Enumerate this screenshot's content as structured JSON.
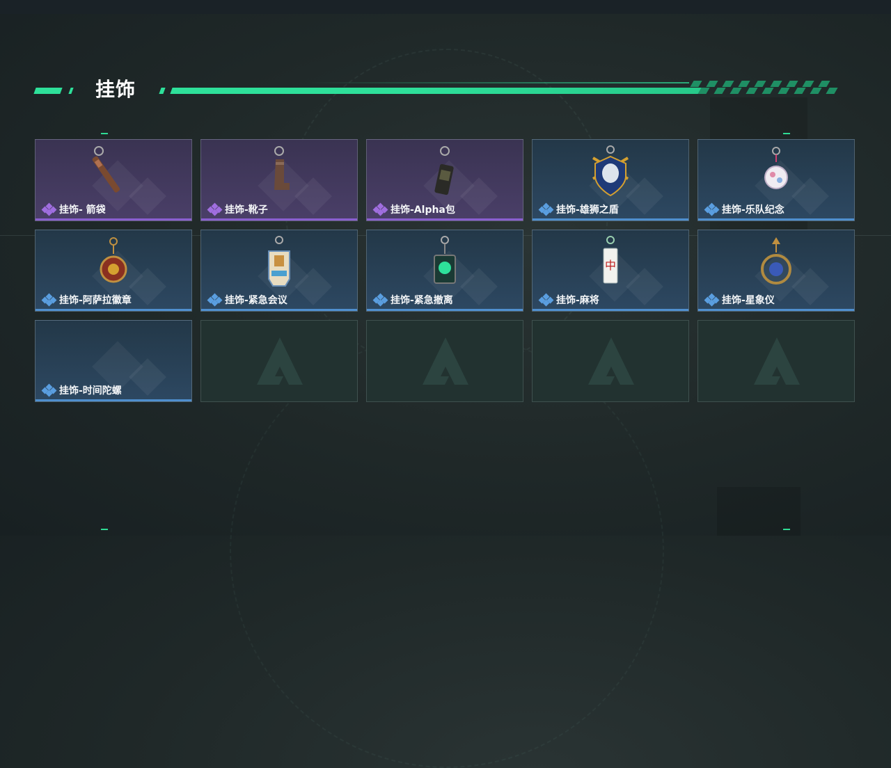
{
  "section": {
    "title": "挂饰"
  },
  "colors": {
    "accent": "#2ee09a",
    "rarity_purple": "#8a5fd0",
    "rarity_blue": "#4f8fcf"
  },
  "items": [
    {
      "name": "挂饰- 箭袋",
      "rarity": "purple",
      "icon": "quiver-charm-icon"
    },
    {
      "name": "挂饰-靴子",
      "rarity": "purple",
      "icon": "boot-charm-icon"
    },
    {
      "name": "挂饰-Alpha包",
      "rarity": "purple",
      "icon": "alpha-bag-charm-icon"
    },
    {
      "name": "挂饰-雄狮之盾",
      "rarity": "blue",
      "icon": "lion-shield-charm-icon"
    },
    {
      "name": "挂饰-乐队纪念",
      "rarity": "blue",
      "icon": "band-badge-charm-icon"
    },
    {
      "name": "挂饰-阿萨拉徽章",
      "rarity": "blue",
      "icon": "asala-emblem-charm-icon"
    },
    {
      "name": "挂饰-紧急会议",
      "rarity": "blue",
      "icon": "emergency-meeting-charm-icon"
    },
    {
      "name": "挂饰-紧急撤离",
      "rarity": "blue",
      "icon": "emergency-evac-charm-icon"
    },
    {
      "name": "挂饰-麻将",
      "rarity": "blue",
      "icon": "mahjong-charm-icon"
    },
    {
      "name": "挂饰-星象仪",
      "rarity": "blue",
      "icon": "astrolabe-charm-icon"
    },
    {
      "name": "挂饰-时间陀螺",
      "rarity": "blue",
      "icon": null
    }
  ],
  "empty_slots": 4
}
